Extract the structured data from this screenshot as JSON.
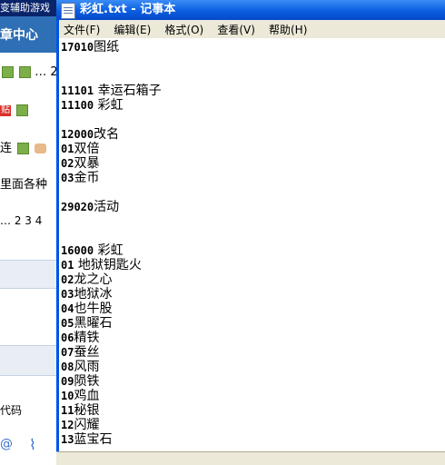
{
  "background": {
    "top_title": "变辅助游戏",
    "header": "章中心",
    "row1_suffix": "… 2",
    "row3_text": "连",
    "row4_text": "里面各种",
    "pager": "… 2 3 4",
    "row_code": "代码"
  },
  "window": {
    "title": "彩虹.txt - 记事本"
  },
  "menu": [
    {
      "label": "文件(F)"
    },
    {
      "label": "编辑(E)"
    },
    {
      "label": "格式(O)"
    },
    {
      "label": "查看(V)"
    },
    {
      "label": "帮助(H)"
    }
  ],
  "lines": [
    {
      "num": "17010",
      "text": "图纸"
    },
    {
      "num": "",
      "text": ""
    },
    {
      "num": "",
      "text": ""
    },
    {
      "num": "11101",
      "text": " 幸运石箱子"
    },
    {
      "num": "11100",
      "text": " 彩虹"
    },
    {
      "num": "",
      "text": ""
    },
    {
      "num": "12000",
      "text": "改名"
    },
    {
      "num": "01",
      "text": "双倍"
    },
    {
      "num": "02",
      "text": "双暴"
    },
    {
      "num": "03",
      "text": "金币"
    },
    {
      "num": "",
      "text": ""
    },
    {
      "num": "29020",
      "text": "活动"
    },
    {
      "num": "",
      "text": ""
    },
    {
      "num": "",
      "text": ""
    },
    {
      "num": "16000",
      "text": " 彩虹"
    },
    {
      "num": "01",
      "text": " 地狱钥匙火"
    },
    {
      "num": "02",
      "text": "龙之心"
    },
    {
      "num": "03",
      "text": "地狱冰"
    },
    {
      "num": "04",
      "text": "也牛股"
    },
    {
      "num": "05",
      "text": "黑曜石"
    },
    {
      "num": "06",
      "text": "精铁"
    },
    {
      "num": "07",
      "text": "蚕丝"
    },
    {
      "num": "08",
      "text": "风雨"
    },
    {
      "num": "09",
      "text": "陨铁"
    },
    {
      "num": "10",
      "text": "鸡血"
    },
    {
      "num": "11",
      "text": "秘银"
    },
    {
      "num": "12",
      "text": "闪耀"
    },
    {
      "num": "13",
      "text": "蓝宝石"
    }
  ]
}
